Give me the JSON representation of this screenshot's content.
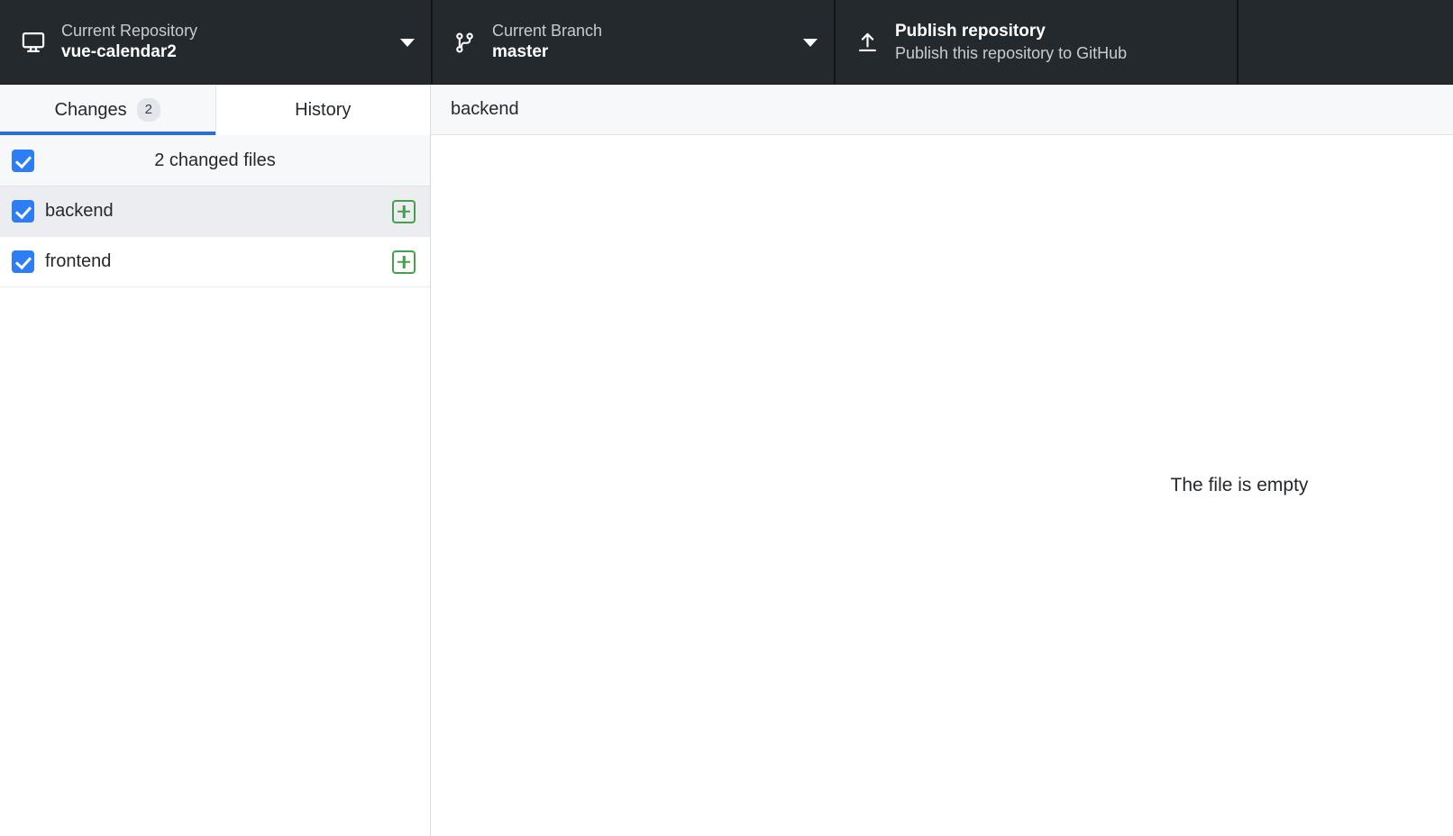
{
  "toolbar": {
    "repository": {
      "icon": "desktop-icon",
      "label": "Current Repository",
      "value": "vue-calendar2",
      "caret": "chevron-down-icon"
    },
    "branch": {
      "icon": "git-branch-icon",
      "label": "Current Branch",
      "value": "master",
      "caret": "chevron-down-icon"
    },
    "publish": {
      "icon": "upload-icon",
      "title": "Publish repository",
      "subtitle": "Publish this repository to GitHub"
    }
  },
  "sidebar": {
    "tabs": [
      {
        "label": "Changes",
        "badge": "2",
        "active": true
      },
      {
        "label": "History",
        "badge": "",
        "active": false
      }
    ],
    "changed_files_header": {
      "label": "2 changed files",
      "checked": true
    },
    "files": [
      {
        "name": "backend",
        "checked": true,
        "status": "new",
        "status_icon": "plus-square-icon",
        "selected": true
      },
      {
        "name": "frontend",
        "checked": true,
        "status": "new",
        "status_icon": "plus-square-icon",
        "selected": false
      }
    ]
  },
  "diff": {
    "header_title": "backend",
    "empty_message": "The file is empty"
  },
  "colors": {
    "toolbar_bg": "#24292e",
    "accent_blue": "#2a6fd6",
    "checkbox_blue": "#2d7df6",
    "status_green": "#46a04b",
    "panel_gray": "#f6f8fa",
    "selected_row": "#ebedf0"
  }
}
